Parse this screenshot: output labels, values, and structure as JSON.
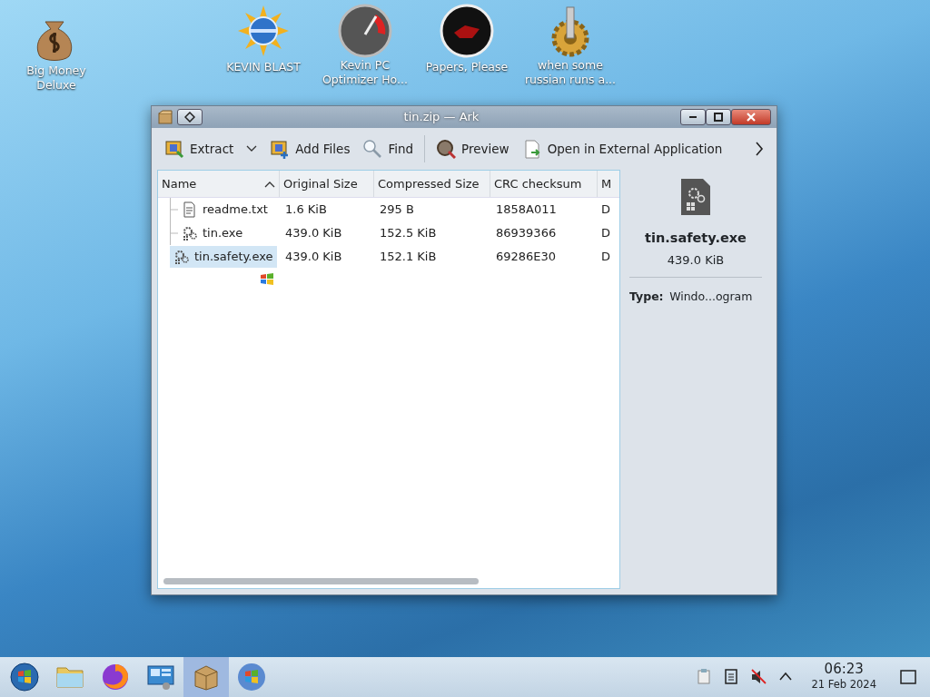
{
  "desktop_icons": [
    {
      "kind": "moneybag",
      "label": "Big Money Deluxe"
    },
    {
      "kind": "sun",
      "label": "KEVIN BLAST"
    },
    {
      "kind": "gauge",
      "label": "Kevin PC Optimizer Ho..."
    },
    {
      "kind": "seal",
      "label": "Papers, Please"
    },
    {
      "kind": "cog",
      "label": "when some russian runs a..."
    }
  ],
  "window": {
    "title": "tin.zip — Ark",
    "toolbar": [
      {
        "kind": "extract",
        "label": "Extract",
        "dropdown": true
      },
      {
        "kind": "add",
        "label": "Add Files",
        "dropdown": false
      },
      {
        "kind": "find",
        "label": "Find",
        "dropdown": false
      },
      {
        "kind": "preview",
        "label": "Preview",
        "dropdown": false
      },
      {
        "kind": "open",
        "label": "Open in External Application",
        "dropdown": false
      }
    ],
    "table": {
      "columns": [
        {
          "label": "Name",
          "sorted": true
        },
        {
          "label": "Original Size",
          "sorted": false
        },
        {
          "label": "Compressed Size",
          "sorted": false
        },
        {
          "label": "CRC checksum",
          "sorted": false
        },
        {
          "label": "M",
          "sorted": false
        }
      ],
      "rows": [
        {
          "kind": "text",
          "name": "readme.txt",
          "original_size": "1.6 KiB",
          "compressed_size": "295 B",
          "crc": "1858A011",
          "column_5": "D",
          "selected": false
        },
        {
          "kind": "exe",
          "name": "tin.exe",
          "original_size": "439.0 KiB",
          "compressed_size": "152.5 KiB",
          "crc": "86939366",
          "column_5": "D",
          "selected": false
        },
        {
          "kind": "exe",
          "name": "tin.safety.exe",
          "original_size": "439.0 KiB",
          "compressed_size": "152.1 KiB",
          "crc": "69286E30",
          "column_5": "D",
          "selected": true
        }
      ]
    },
    "details": {
      "name": "tin.safety.exe",
      "size": "439.0 KiB",
      "type_label": "Type:",
      "type_value": "Windo...ogram"
    }
  },
  "taskbar": {
    "items": [
      {
        "kind": "start",
        "selected": false
      },
      {
        "kind": "folder",
        "selected": false
      },
      {
        "kind": "browser",
        "selected": false
      },
      {
        "kind": "monitor",
        "selected": false
      },
      {
        "kind": "archive",
        "selected": true
      },
      {
        "kind": "winlogo",
        "selected": false
      }
    ],
    "clock": {
      "time": "06:23",
      "date": "21 Feb 2024"
    }
  }
}
